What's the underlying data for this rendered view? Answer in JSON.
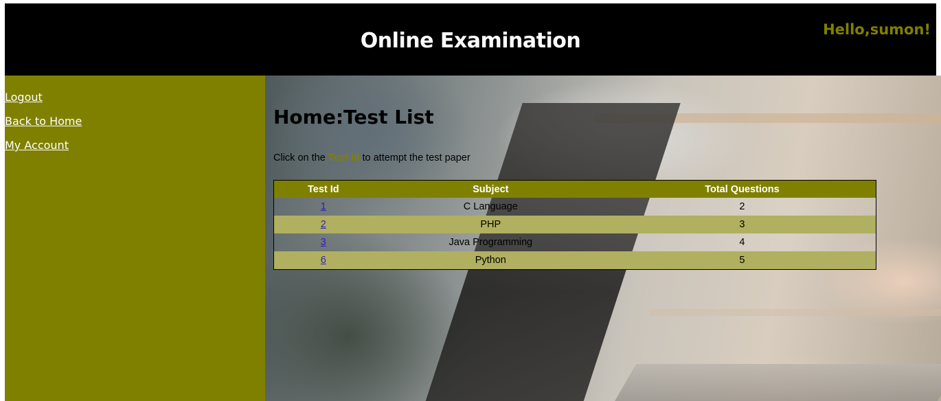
{
  "header": {
    "title": "Online Examination",
    "greeting": "Hello,sumon!"
  },
  "sidebar": {
    "items": [
      {
        "label": "Logout"
      },
      {
        "label": "Back to Home"
      },
      {
        "label": "My Account"
      }
    ]
  },
  "main": {
    "page_title": "Home:Test List",
    "instruction": {
      "prefix": "Click on the ",
      "highlight": "Test Id",
      "suffix": " to attempt the test paper"
    },
    "table": {
      "headers": [
        "Test Id",
        "Subject",
        "Total Questions"
      ],
      "rows": [
        {
          "id": "1",
          "subject": "C Language",
          "total": "2"
        },
        {
          "id": "2",
          "subject": "PHP",
          "total": "3"
        },
        {
          "id": "3",
          "subject": "Java Programming",
          "total": "4"
        },
        {
          "id": "6",
          "subject": "Python",
          "total": "5"
        }
      ]
    }
  },
  "colors": {
    "header_bg": "#000000",
    "accent_olive": "#808000",
    "row_alt": "#b0b060",
    "link": "#2a1fc8"
  }
}
